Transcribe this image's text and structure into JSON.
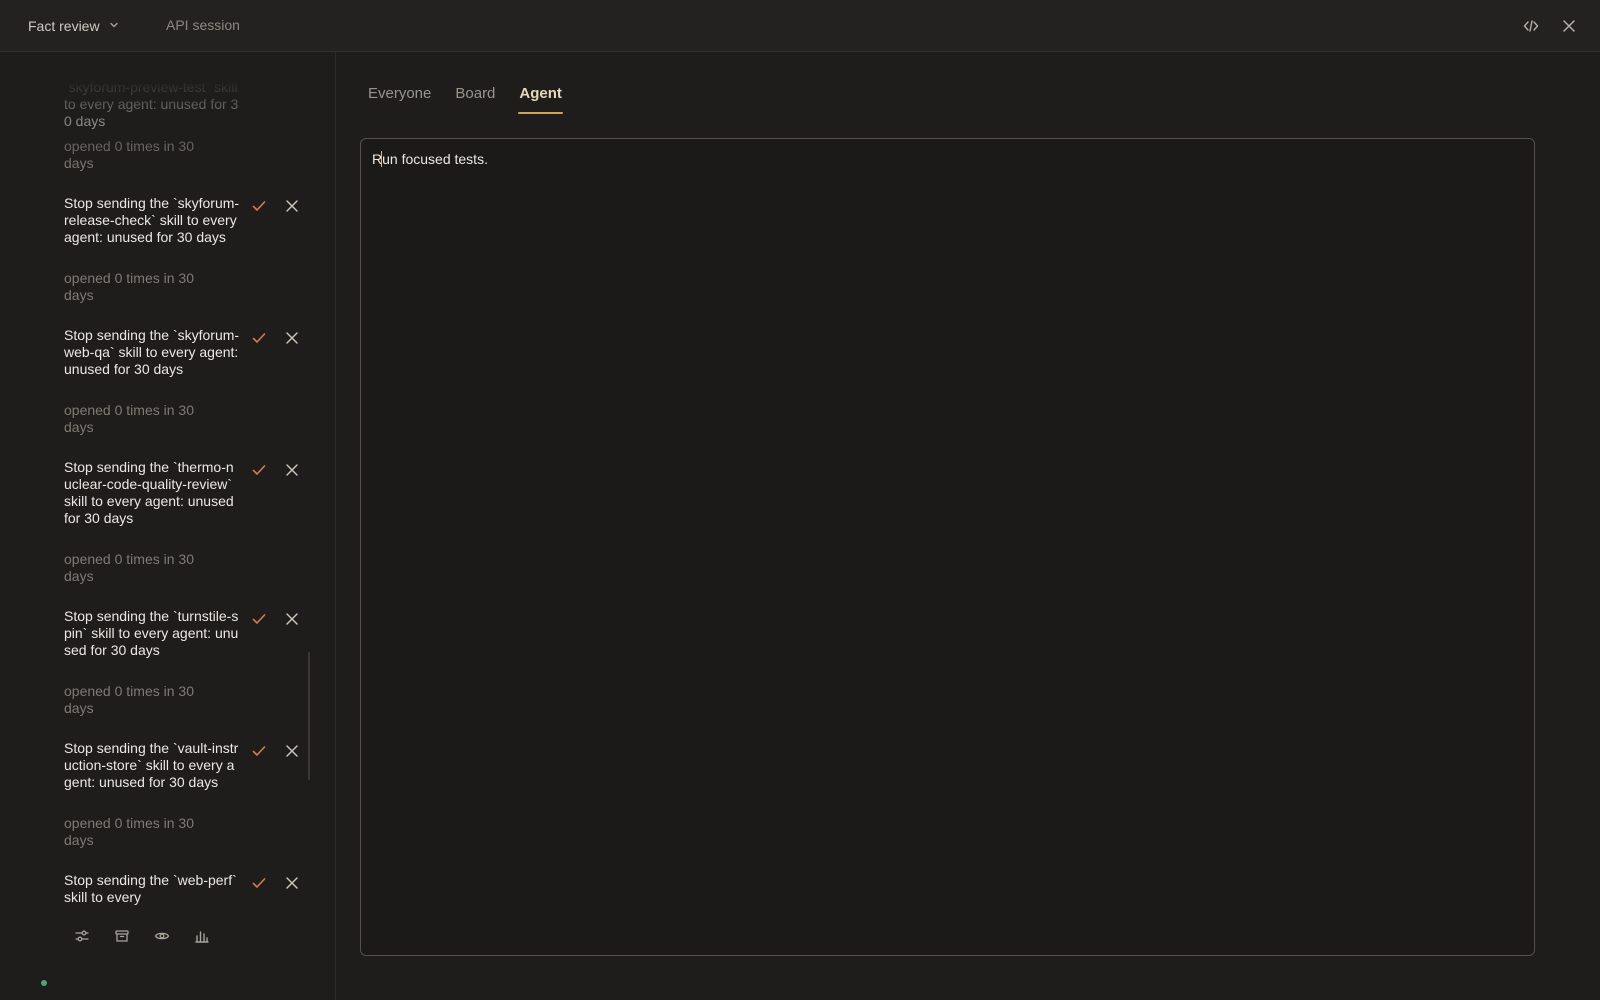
{
  "header": {
    "mode_label": "Fact review",
    "session_label": "API session"
  },
  "facts": {
    "items": [
      {
        "title": "`skyforum-preview-test` skill to every agent: unused for 30 days",
        "meta": "opened 0 times in 30 days"
      },
      {
        "title": "Stop sending the `skyforum-release-check` skill to every agent: unused for 30 days",
        "meta": "opened 0 times in 30 days"
      },
      {
        "title": "Stop sending the `skyforum-web-qa` skill to every agent: unused for 30 days",
        "meta": "opened 0 times in 30 days"
      },
      {
        "title": "Stop sending the `thermo-nuclear-code-quality-review` skill to every agent: unused for 30 days",
        "meta": "opened 0 times in 30 days"
      },
      {
        "title": "Stop sending the `turnstile-spin` skill to every agent: unused for 30 days",
        "meta": "opened 0 times in 30 days"
      },
      {
        "title": "Stop sending the `vault-instruction-store` skill to every agent: unused for 30 days",
        "meta": "opened 0 times in 30 days"
      },
      {
        "title": "Stop sending the `web-perf` skill to every",
        "meta": ""
      }
    ]
  },
  "toolbar": {
    "icons": [
      "sliders-icon",
      "archive-icon",
      "eye-icon",
      "bar-chart-icon"
    ]
  },
  "tabs": [
    {
      "label": "Everyone",
      "active": false
    },
    {
      "label": "Board",
      "active": false
    },
    {
      "label": "Agent",
      "active": true
    }
  ],
  "editor": {
    "value_first": "R",
    "value_rest": "un focused tests."
  },
  "colors": {
    "accent": "#c9a25f",
    "accept": "#d9784f",
    "status_dot": "#4fa37a"
  }
}
